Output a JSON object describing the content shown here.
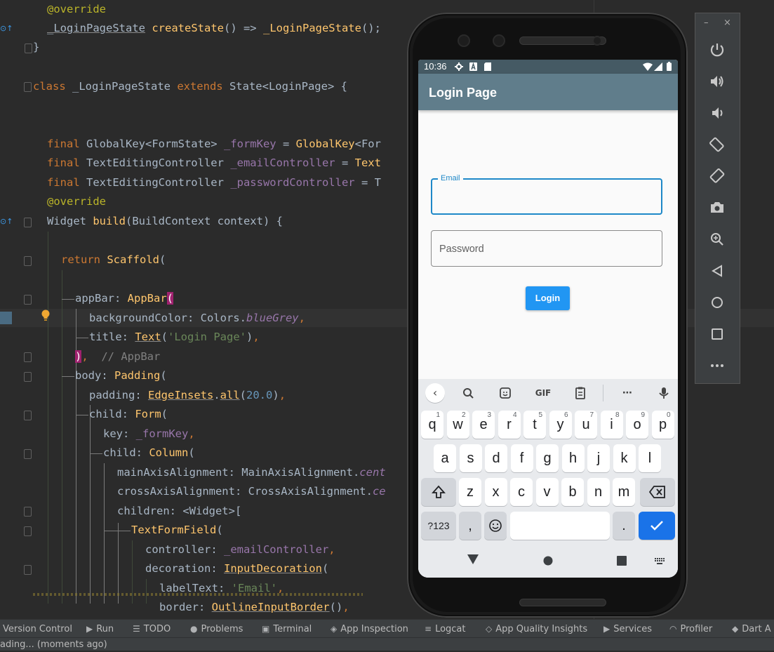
{
  "editor": {
    "lines": [
      [
        [
          "an",
          "@override"
        ]
      ],
      [
        [
          "pl ul",
          "_LoginPageState"
        ],
        [
          "pl",
          " "
        ],
        [
          "fn",
          "createState"
        ],
        [
          "pl",
          "() => "
        ],
        [
          "fn",
          "_LoginPageState"
        ],
        [
          "pl",
          "();"
        ]
      ],
      [
        [
          "pl",
          "}"
        ]
      ],
      [
        [
          "pl",
          ""
        ]
      ],
      [
        [
          "kw",
          "class "
        ],
        [
          "pl",
          "_LoginPageState "
        ],
        [
          "kw",
          "extends "
        ],
        [
          "pl",
          "State<LoginPage> {"
        ]
      ],
      [
        [
          "pl",
          ""
        ]
      ],
      [
        [
          "kw",
          "final "
        ],
        [
          "pl",
          "GlobalKey<FormState> "
        ],
        [
          "fld",
          "_formKey"
        ],
        [
          "pl",
          " = "
        ],
        [
          "fn",
          "GlobalKey"
        ],
        [
          "pl",
          "<For"
        ]
      ],
      [
        [
          "kw",
          "final "
        ],
        [
          "pl",
          "TextEditingController "
        ],
        [
          "fld",
          "_emailController"
        ],
        [
          "pl",
          " = "
        ],
        [
          "fn",
          "Text"
        ]
      ],
      [
        [
          "kw",
          "final "
        ],
        [
          "pl",
          "TextEditingController "
        ],
        [
          "fld",
          "_passwordController"
        ],
        [
          "pl",
          " = T"
        ]
      ],
      [
        [
          "pl",
          ""
        ]
      ],
      [
        [
          "an",
          "@override"
        ]
      ],
      [
        [
          "pl",
          "Widget "
        ],
        [
          "fn",
          "build"
        ],
        [
          "pl",
          "(BuildContext context) {"
        ]
      ],
      [
        [
          "pl",
          ""
        ]
      ],
      [
        [
          "kw",
          "return "
        ],
        [
          "fn",
          "Scaffold"
        ],
        [
          "pl",
          "("
        ]
      ],
      [
        [
          "pl",
          ""
        ]
      ],
      [
        [
          "pl",
          "appBar: "
        ],
        [
          "fn",
          "AppBar"
        ],
        [
          "brk",
          "("
        ]
      ],
      [
        [
          "pl",
          "backgroundColor: Colors."
        ],
        [
          "ita",
          "blueGrey"
        ],
        [
          "kw",
          ","
        ]
      ],
      [
        [
          "pl",
          "title: "
        ],
        [
          "fn ul",
          "Text"
        ],
        [
          "pl",
          "("
        ],
        [
          "str",
          "'Login Page'"
        ],
        [
          "pl",
          ")"
        ],
        [
          "kw",
          ","
        ]
      ],
      [
        [
          "brk",
          ")"
        ],
        [
          "kw",
          ","
        ],
        [
          "cm",
          "  // AppBar"
        ]
      ],
      [
        [
          "pl",
          "body: "
        ],
        [
          "fn",
          "Padding"
        ],
        [
          "pl",
          "("
        ]
      ],
      [
        [
          "pl",
          "padding: "
        ],
        [
          "fn ul",
          "EdgeInsets"
        ],
        [
          "pl",
          "."
        ],
        [
          "fn ul",
          "all"
        ],
        [
          "pl",
          "("
        ],
        [
          "num",
          "20.0"
        ],
        [
          "pl",
          ")"
        ],
        [
          "kw",
          ","
        ]
      ],
      [
        [
          "pl",
          "child: "
        ],
        [
          "fn",
          "Form"
        ],
        [
          "pl",
          "("
        ]
      ],
      [
        [
          "pl",
          "key: "
        ],
        [
          "fld",
          "_formKey"
        ],
        [
          "kw",
          ","
        ]
      ],
      [
        [
          "pl",
          "child: "
        ],
        [
          "fn",
          "Column"
        ],
        [
          "pl",
          "("
        ]
      ],
      [
        [
          "pl",
          "mainAxisAlignment: MainAxisAlignment."
        ],
        [
          "ita",
          "cent"
        ]
      ],
      [
        [
          "pl",
          "crossAxisAlignment: CrossAxisAlignment."
        ],
        [
          "ita",
          "ce"
        ]
      ],
      [
        [
          "pl",
          "children: <Widget>["
        ]
      ],
      [
        [
          "fn",
          "TextFormField"
        ],
        [
          "pl",
          "("
        ]
      ],
      [
        [
          "pl",
          "controller: "
        ],
        [
          "fld",
          "_emailController"
        ],
        [
          "kw",
          ","
        ]
      ],
      [
        [
          "pl",
          "decoration: "
        ],
        [
          "fn ul",
          "InputDecoration"
        ],
        [
          "pl",
          "("
        ]
      ],
      [
        [
          "pl",
          "labelText: "
        ],
        [
          "str",
          "'Email'"
        ],
        [
          "kw",
          ","
        ]
      ],
      [
        [
          "pl",
          "border: "
        ],
        [
          "fn ul",
          "OutlineInputBorder"
        ],
        [
          "pl",
          "()"
        ],
        [
          "kw",
          ","
        ]
      ]
    ]
  },
  "toolbar": {
    "items": [
      {
        "label": "Version Control",
        "icon": "version-control-icon",
        "glyph": ""
      },
      {
        "label": "Run",
        "icon": "run-icon",
        "glyph": "▶"
      },
      {
        "label": "TODO",
        "icon": "todo-icon",
        "glyph": "☰"
      },
      {
        "label": "Problems",
        "icon": "problems-icon",
        "glyph": "●"
      },
      {
        "label": "Terminal",
        "icon": "terminal-icon",
        "glyph": "▣"
      },
      {
        "label": "App Inspection",
        "icon": "app-inspection-icon",
        "glyph": "◈"
      },
      {
        "label": "Logcat",
        "icon": "logcat-icon",
        "glyph": "≡"
      },
      {
        "label": "App Quality Insights",
        "icon": "app-quality-insights-icon",
        "glyph": "◇"
      },
      {
        "label": "Services",
        "icon": "services-icon",
        "glyph": "▶"
      },
      {
        "label": "Profiler",
        "icon": "profiler-icon",
        "glyph": "◠"
      },
      {
        "label": "Dart A",
        "icon": "dart-analysis-icon",
        "glyph": "◆"
      }
    ],
    "status": "ading... (moments ago)"
  },
  "phone": {
    "status_time": "10:36",
    "app_title": "Login Page",
    "email_label": "Email",
    "password_placeholder": "Password",
    "login_label": "Login",
    "keyboard": {
      "tools": [
        "<",
        "search",
        "sticker",
        "GIF",
        "clipboard",
        "more",
        "mic"
      ],
      "row1": [
        [
          "q",
          "1"
        ],
        [
          "w",
          "2"
        ],
        [
          "e",
          "3"
        ],
        [
          "r",
          "4"
        ],
        [
          "t",
          "5"
        ],
        [
          "y",
          "6"
        ],
        [
          "u",
          "7"
        ],
        [
          "i",
          "8"
        ],
        [
          "o",
          "9"
        ],
        [
          "p",
          "0"
        ]
      ],
      "row2": [
        "a",
        "s",
        "d",
        "f",
        "g",
        "h",
        "j",
        "k",
        "l"
      ],
      "row3": [
        "z",
        "x",
        "c",
        "v",
        "b",
        "n",
        "m"
      ],
      "symbols": "?123",
      "comma": ",",
      "period": "."
    }
  },
  "side_panel": {
    "minimize": "–",
    "close": "×",
    "buttons": [
      "power-icon",
      "volume-up-icon",
      "volume-down-icon",
      "rotate-left-icon",
      "rotate-right-icon",
      "screenshot-icon",
      "zoom-icon",
      "back-icon",
      "home-icon",
      "overview-icon",
      "more-icon"
    ]
  },
  "colors": {
    "appbar": "#607d8b",
    "statusbar": "#455a64",
    "accent": "#2196f3",
    "editor_bg": "#2b2b2b"
  }
}
